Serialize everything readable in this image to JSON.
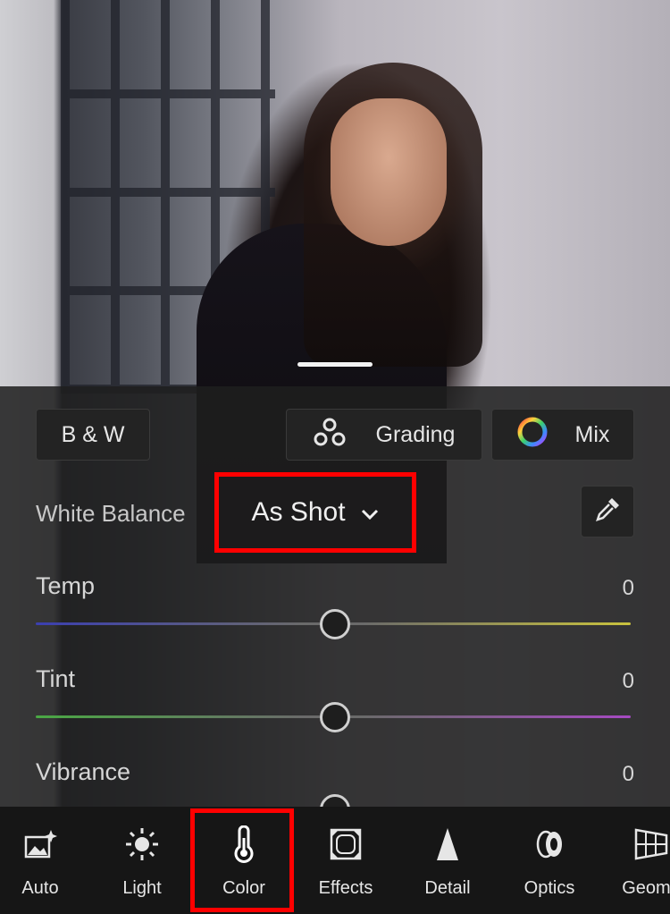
{
  "buttons": {
    "bw_label": "B & W",
    "grading_label": "Grading",
    "mix_label": "Mix"
  },
  "white_balance": {
    "label": "White Balance",
    "value": "As Shot"
  },
  "sliders": [
    {
      "label": "Temp",
      "value": "0"
    },
    {
      "label": "Tint",
      "value": "0"
    },
    {
      "label": "Vibrance",
      "value": "0"
    }
  ],
  "toolbar": [
    {
      "label": "Auto",
      "icon": "auto-icon"
    },
    {
      "label": "Light",
      "icon": "sun-icon"
    },
    {
      "label": "Color",
      "icon": "thermometer-icon",
      "active": true
    },
    {
      "label": "Effects",
      "icon": "effects-icon"
    },
    {
      "label": "Detail",
      "icon": "triangle-icon"
    },
    {
      "label": "Optics",
      "icon": "lens-icon"
    },
    {
      "label": "Geome",
      "icon": "geometry-icon"
    }
  ],
  "colors": {
    "highlight": "#ff0000",
    "panel_bg": "#1e1e1e",
    "temp_left": "#3b3fb0",
    "temp_right": "#c9c23e",
    "tint_left": "#4aa844",
    "tint_right": "#a64ac2"
  }
}
